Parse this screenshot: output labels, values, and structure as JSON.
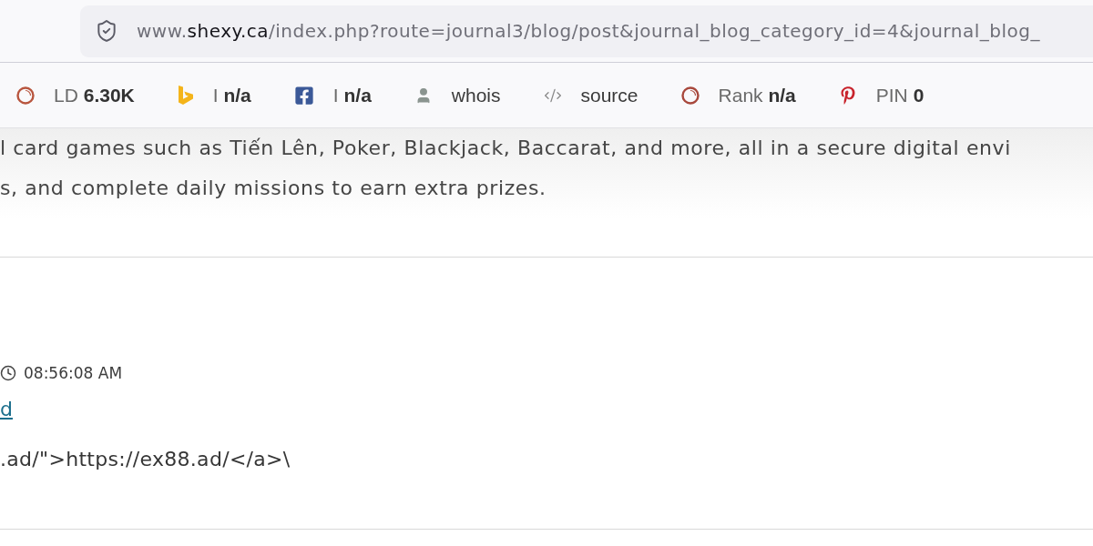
{
  "address_bar": {
    "url": "www.**shexy.ca**/index.php?route=journal3/blog/post&journal_blog_category_id=4&journal_blog_"
  },
  "toolbar": {
    "items": [
      {
        "kind": "ld",
        "label": "LD",
        "value": "6.30K"
      },
      {
        "kind": "bing",
        "label": "I",
        "value": "n/a"
      },
      {
        "kind": "facebook",
        "label": "I",
        "value": "n/a"
      },
      {
        "kind": "whois",
        "label": "whois"
      },
      {
        "kind": "source",
        "label": "source"
      },
      {
        "kind": "rank",
        "label": "Rank",
        "value": "n/a"
      },
      {
        "kind": "pinterest",
        "label": "PIN",
        "value": "0"
      }
    ]
  },
  "post": {
    "description_lines": [
      "l card games such as Tiến Lên, Poker, Blackjack, Baccarat, and more, all in a secure digital envi",
      "s, and complete daily missions to earn extra prizes."
    ]
  },
  "comment": {
    "time": "08:56:08 AM",
    "link": "d",
    "body": ".ad/\">https://ex88.ad/</a>\\"
  }
}
